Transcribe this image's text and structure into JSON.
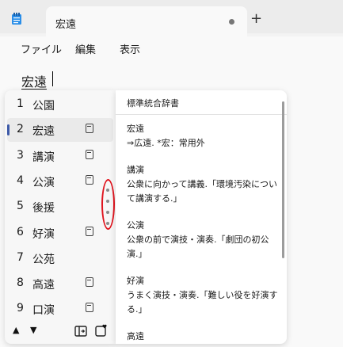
{
  "tab": {
    "title": "宏遠"
  },
  "menu": [
    "ファイル",
    "編集",
    "表示"
  ],
  "editor": {
    "composition": "宏遠"
  },
  "candidates": [
    {
      "num": "1",
      "word": "公園",
      "dict": false
    },
    {
      "num": "2",
      "word": "宏遠",
      "dict": true,
      "selected": true
    },
    {
      "num": "3",
      "word": "講演",
      "dict": true
    },
    {
      "num": "4",
      "word": "公演",
      "dict": true
    },
    {
      "num": "5",
      "word": "後援",
      "dict": false
    },
    {
      "num": "6",
      "word": "好演",
      "dict": true
    },
    {
      "num": "7",
      "word": "公苑",
      "dict": false
    },
    {
      "num": "8",
      "word": "高遠",
      "dict": true
    },
    {
      "num": "9",
      "word": "口演",
      "dict": true
    }
  ],
  "dictionary": {
    "header": "標準統合辞書",
    "entries": [
      {
        "head": "宏遠",
        "body": "⇒広遠. *宏：常用外"
      },
      {
        "head": "講演",
        "body": "公衆に向かって講義.「環境汚染について講演する.」"
      },
      {
        "head": "公演",
        "body": "公衆の前で演技・演奏.「劇団の初公演.」"
      },
      {
        "head": "好演",
        "body": "うまく演技・演奏.「難しい役を好演する.」"
      },
      {
        "head": "高遠",
        "body": ""
      }
    ]
  },
  "footer": {
    "up": "▲",
    "down": "▼"
  }
}
